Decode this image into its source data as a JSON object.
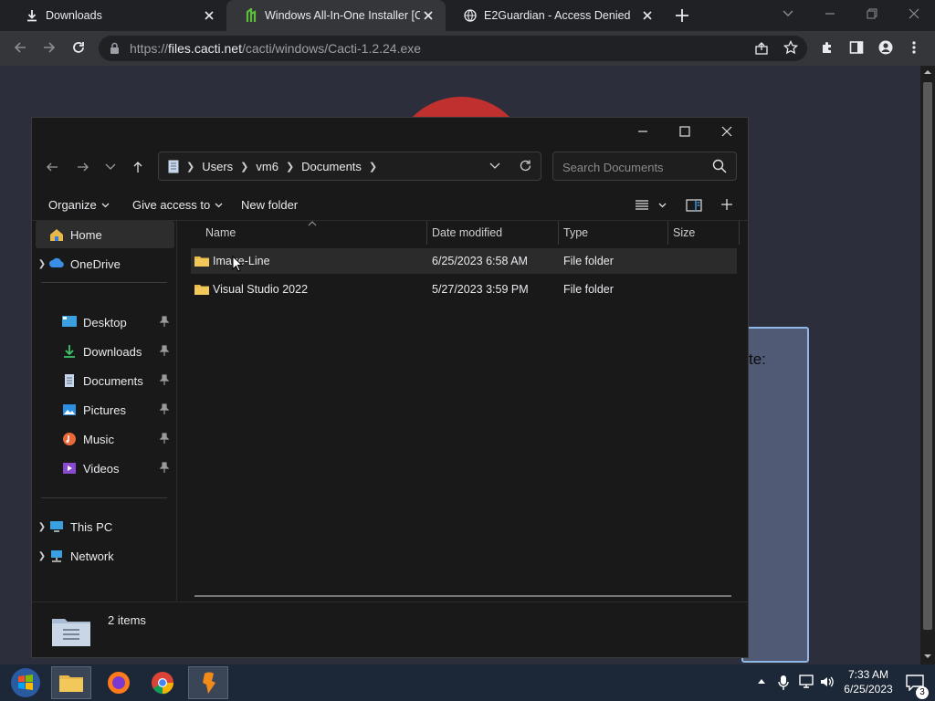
{
  "browser": {
    "tabs": [
      {
        "title": "Downloads",
        "icon": "download-icon"
      },
      {
        "title": "Windows All-In-One Installer [Ca",
        "icon": "cacti-favicon"
      },
      {
        "title": "E2Guardian - Access Denied",
        "icon": "globe-icon"
      }
    ],
    "address": {
      "host": "files.cacti.net",
      "path": "/cacti/windows/Cacti-1.2.24.exe",
      "scheme": "https://"
    }
  },
  "background_page": {
    "partial_text": "te:"
  },
  "explorer": {
    "breadcrumb": [
      "Users",
      "vm6",
      "Documents"
    ],
    "search_placeholder": "Search Documents",
    "commands": {
      "organize": "Organize",
      "give_access": "Give access to",
      "new_folder": "New folder"
    },
    "sidebar": {
      "top": [
        {
          "label": "Home",
          "icon": "home-icon"
        },
        {
          "label": "OneDrive",
          "icon": "cloud-icon"
        }
      ],
      "pinned": [
        {
          "label": "Desktop",
          "icon": "desktop-icon"
        },
        {
          "label": "Downloads",
          "icon": "download-arrow-icon"
        },
        {
          "label": "Documents",
          "icon": "document-icon"
        },
        {
          "label": "Pictures",
          "icon": "pictures-icon"
        },
        {
          "label": "Music",
          "icon": "music-icon"
        },
        {
          "label": "Videos",
          "icon": "videos-icon"
        }
      ],
      "bottom": [
        {
          "label": "This PC",
          "icon": "computer-icon"
        },
        {
          "label": "Network",
          "icon": "network-icon"
        }
      ]
    },
    "columns": [
      "Name",
      "Date modified",
      "Type",
      "Size"
    ],
    "files": [
      {
        "name": "Image-Line",
        "date": "6/25/2023 6:58 AM",
        "type": "File folder",
        "size": ""
      },
      {
        "name": "Visual Studio 2022",
        "date": "5/27/2023 3:59 PM",
        "type": "File folder",
        "size": ""
      }
    ],
    "status": "2 items"
  },
  "taskbar": {
    "time": "7:33 AM",
    "date": "6/25/2023",
    "notification_count": "3"
  },
  "colors": {
    "folder": "#e8b84a",
    "accent": "#4aa3f0"
  }
}
